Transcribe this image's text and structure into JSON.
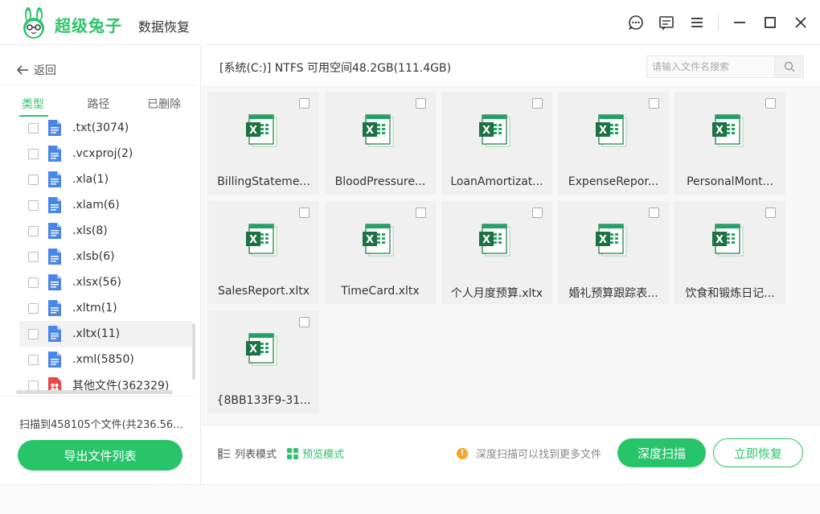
{
  "app": {
    "brand": "超级兔子",
    "subtitle": "数据恢复"
  },
  "left": {
    "back_label": "返回",
    "tabs": [
      "类型",
      "路径",
      "已删除"
    ],
    "active_tab": 0,
    "file_types": [
      {
        "label": ".txt(3074)",
        "icon": "document-icon"
      },
      {
        "label": ".vcxproj(2)",
        "icon": "document-icon"
      },
      {
        "label": ".xla(1)",
        "icon": "document-icon"
      },
      {
        "label": ".xlam(6)",
        "icon": "document-icon"
      },
      {
        "label": ".xls(8)",
        "icon": "document-icon"
      },
      {
        "label": ".xlsb(6)",
        "icon": "document-icon"
      },
      {
        "label": ".xlsx(56)",
        "icon": "document-icon"
      },
      {
        "label": ".xltm(1)",
        "icon": "document-icon"
      },
      {
        "label": ".xltx(11)",
        "icon": "document-icon",
        "selected": true
      },
      {
        "label": ".xml(5850)",
        "icon": "document-icon"
      },
      {
        "label": "其他文件(362329)",
        "icon": "other-files-icon",
        "expandable": true
      }
    ],
    "scan_summary": "扫描到458105个文件(共236.56...",
    "export_button": "导出文件列表"
  },
  "right": {
    "path": "[系统(C:)] NTFS 可用空间48.2GB(111.4GB)",
    "search_placeholder": "请输入文件名搜索",
    "files": [
      "BillingStateme...",
      "BloodPressure...",
      "LoanAmortizat...",
      "ExpenseRepor...",
      "PersonalMont...",
      "SalesReport.xltx",
      "TimeCard.xltx",
      "个人月度预算.xltx",
      "婚礼预算跟踪表...",
      "饮食和锻炼日记...",
      "{8BB133F9-31..."
    ],
    "view_modes": {
      "list": "列表模式",
      "preview": "预览模式"
    },
    "tip": "深度扫描可以找到更多文件",
    "deep_scan_button": "深度扫描",
    "recover_button": "立即恢复"
  },
  "colors": {
    "accent": "#28c46a",
    "excel_green": "#1e7145",
    "doc_blue": "#4a86e8",
    "tip_orange": "#f5a623"
  }
}
